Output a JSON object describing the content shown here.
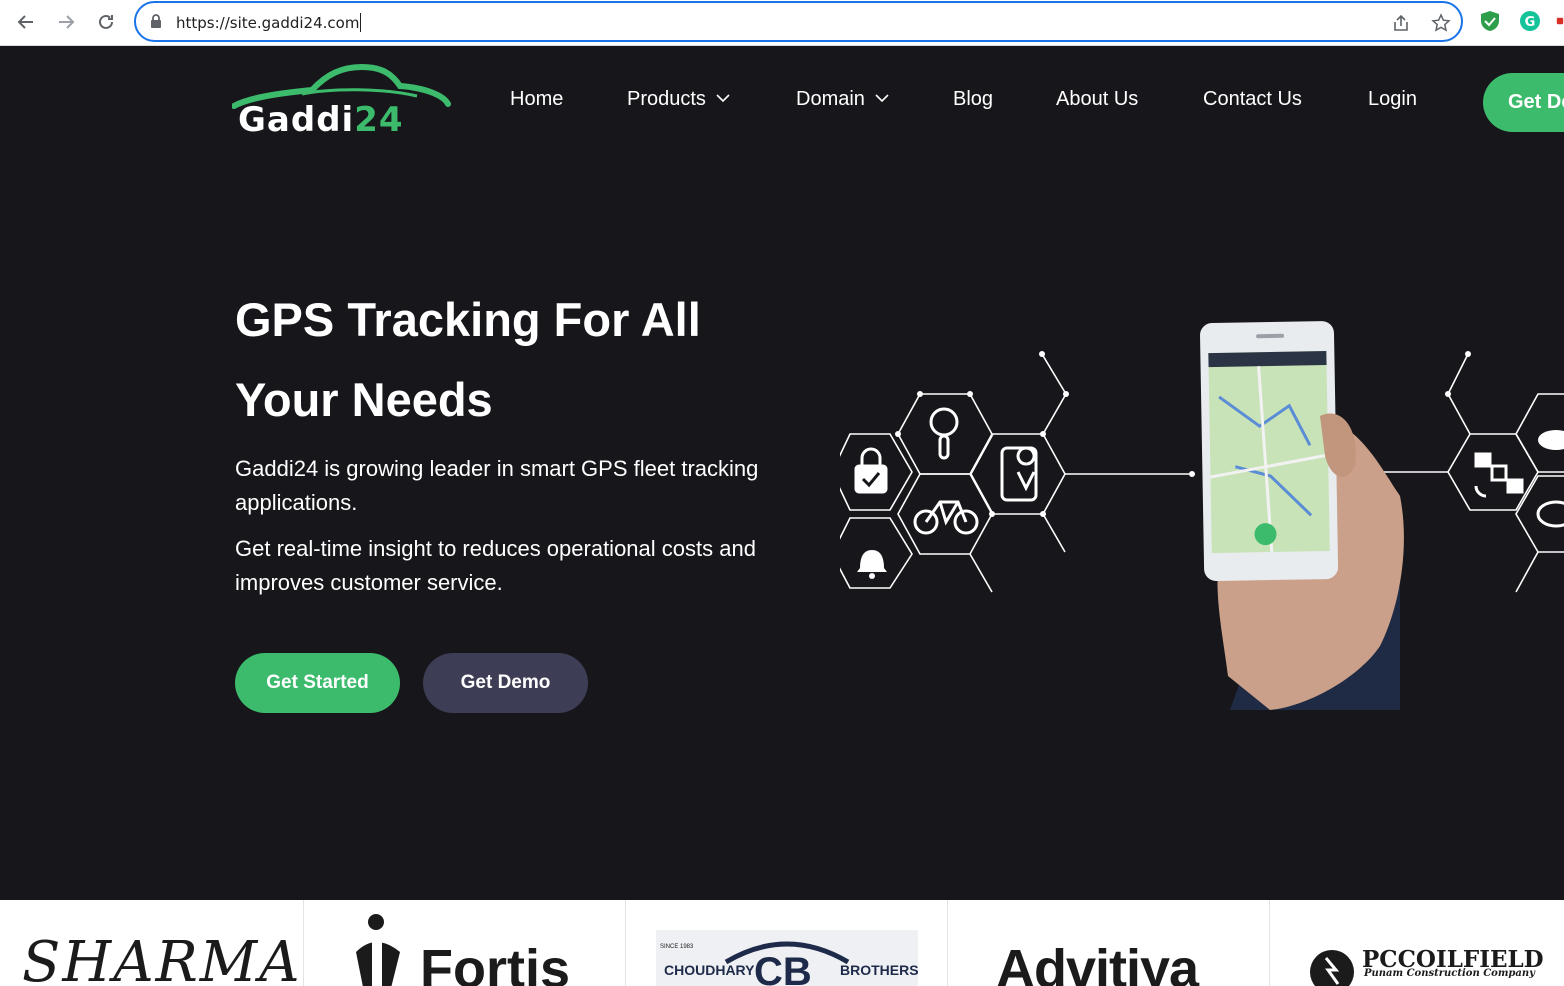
{
  "browser": {
    "url": "https://site.gaddi24.com",
    "icons": [
      "back-arrow-icon",
      "forward-arrow-icon",
      "reload-icon",
      "lock-icon",
      "share-icon",
      "star-icon",
      "shield-extension-icon",
      "grammarly-extension-icon"
    ]
  },
  "site": {
    "logo": {
      "text_main": "Gaddi",
      "text_num": "24"
    },
    "nav": {
      "home": "Home",
      "products": "Products",
      "domain": "Domain",
      "blog": "Blog",
      "about": "About Us",
      "contact": "Contact Us",
      "login": "Login",
      "cta": "Get Demo"
    },
    "hero": {
      "title": "GPS Tracking For All Your Needs",
      "para1": "Gaddi24 is growing leader in smart GPS fleet tracking applications.",
      "para2": "Get real-time insight to reduces operational costs and improves customer service.",
      "btn_start": "Get Started",
      "btn_demo": "Get Demo"
    },
    "clients": [
      {
        "name": "SHARMA"
      },
      {
        "name": "Fortis"
      },
      {
        "name": "CB",
        "left": "CHOUDHARY",
        "right": "BROTHERS",
        "since": "SINCE 1983"
      },
      {
        "name": "Advitiya"
      },
      {
        "name": "PCCOILFIELD",
        "tagline": "Punam Construction Company"
      }
    ]
  },
  "colors": {
    "page_bg": "#16161b",
    "brand_green": "#3dbb6c",
    "demo_button": "#3e3d56",
    "focus_ring": "#1a73e8"
  }
}
